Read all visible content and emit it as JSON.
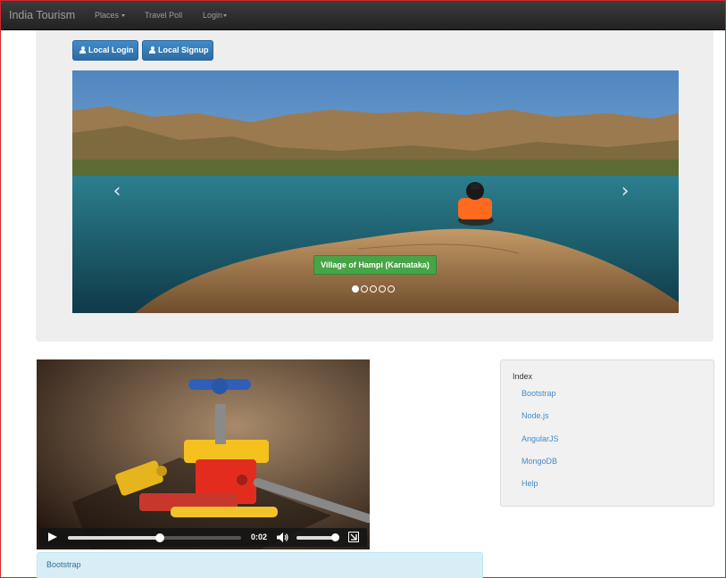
{
  "navbar": {
    "brand": "India Tourism",
    "items": [
      {
        "label": "Places",
        "has_caret": true
      },
      {
        "label": "Travel Poll",
        "has_caret": false
      },
      {
        "label": "Login",
        "has_caret": true
      }
    ]
  },
  "auth_buttons": {
    "login_label": "Local Login",
    "signup_label": "Local Signup"
  },
  "carousel": {
    "caption": "Village of Hampi (Karnataka)",
    "slide_count": 5,
    "active_index": 0,
    "prev_icon": "chevron-left-icon",
    "next_icon": "chevron-right-icon"
  },
  "video": {
    "time": "0:02",
    "progress": 0.53,
    "volume": 0.95
  },
  "panel": {
    "title": "Bootstrap"
  },
  "sidebar": {
    "title": "Index",
    "links": [
      "Bootstrap",
      "Node.js",
      "AngularJS",
      "MongoDB",
      "Help"
    ]
  },
  "colors": {
    "navbar_bg": "#222222",
    "primary": "#428bca",
    "success": "#47a447",
    "jumbotron_bg": "#eeeeee",
    "info_bg": "#d9edf7",
    "link": "#428bca"
  }
}
